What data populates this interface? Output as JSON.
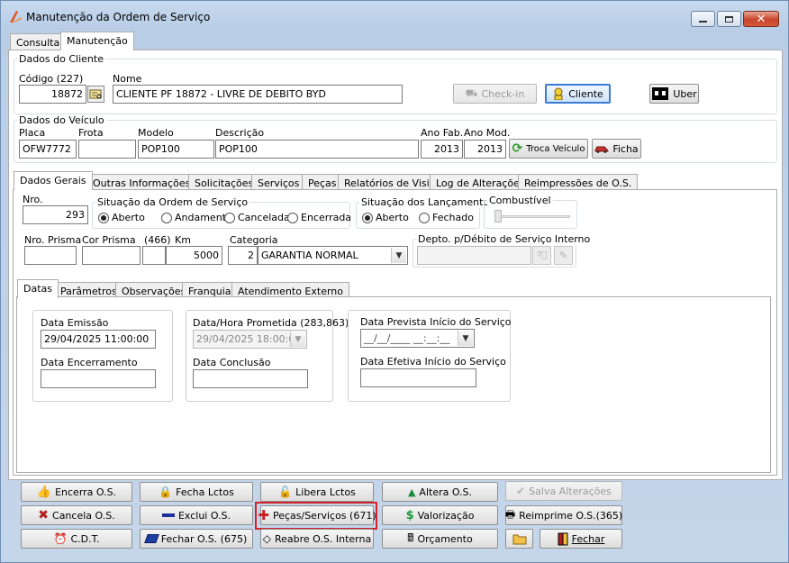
{
  "window": {
    "title": "Manutenção da Ordem de Serviço"
  },
  "top_tabs": [
    "Consulta",
    "Manutenção"
  ],
  "cliente": {
    "group": "Dados do Cliente",
    "codigo_label": "Código (227)",
    "codigo": "18872",
    "nome_label": "Nome",
    "nome": "CLIENTE PF 18872 - LIVRE DE DEBITO BYD",
    "checkin": "Check-in",
    "cliente_btn": "Cliente",
    "uber_btn": "Uber"
  },
  "veiculo": {
    "group": "Dados do Veículo",
    "placa_label": "Placa",
    "placa": "OFW7772",
    "frota_label": "Frota",
    "frota": "",
    "modelo_label": "Modelo",
    "modelo": "POP100",
    "descricao_label": "Descrição",
    "descricao": "POP100",
    "anofab_label": "Ano Fab.",
    "anofab": "2013",
    "anomod_label": "Ano Mod.",
    "anomod": "2013",
    "troca_btn": "Troca Veículo",
    "ficha_btn": "Ficha"
  },
  "main_tabs": [
    "Dados Gerais",
    "Outras Informações",
    "Solicitações",
    "Serviços",
    "Peças",
    "Relatórios de Visita",
    "Log de Alterações",
    "Reimpressões de O.S."
  ],
  "gerais": {
    "nro_label": "Nro.",
    "nro": "293",
    "situacao_group": "Situação da Ordem de Serviço",
    "situacao_options": [
      "Aberto",
      "Andamento",
      "Cancelada",
      "Encerrada"
    ],
    "situacao_selected": "Aberto",
    "lanc_group": "Situação dos Lançamentos",
    "lanc_options": [
      "Aberto",
      "Fechado"
    ],
    "lanc_selected": "Aberto",
    "combustivel_group": "Combustível",
    "nro_prisma_label": "Nro. Prisma",
    "nro_prisma": "",
    "cor_prisma_label": "Cor Prisma",
    "cor_prisma": "",
    "km_code_label": "(466)",
    "km_label": "Km",
    "km": "5000",
    "categoria_label": "Categoria",
    "categoria_code": "2",
    "categoria": "GARANTIA NORMAL",
    "depto_group": "Depto. p/Débito de Serviço Interno"
  },
  "sub_tabs": [
    "Datas",
    "Parâmetros",
    "Observações",
    "Franquia",
    "Atendimento Externo"
  ],
  "datas": {
    "emissao_label": "Data Emissão",
    "emissao": "29/04/2025 11:00:00",
    "encerramento_label": "Data Encerramento",
    "encerramento": "",
    "prometida_label": "Data/Hora Prometida (283,863)",
    "prometida": "29/04/2025 18:00:00",
    "conclusao_label": "Data Conclusão",
    "conclusao": "",
    "prev_inicio_label": "Data Prevista Início do Serviço",
    "prev_inicio": "__/__/____ __:__:__",
    "efet_inicio_label": "Data Efetiva Início do Serviço",
    "efet_inicio": ""
  },
  "actions": {
    "encerra": "Encerra O.S.",
    "fecha_lctos": "Fecha Lctos",
    "libera_lctos": "Libera Lctos",
    "altera": "Altera O.S.",
    "salva": "Salva Alterações",
    "cancela": "Cancela O.S.",
    "exclui": "Exclui O.S.",
    "pecas_servicos": "Peças/Serviços (671)",
    "valorizacao": "Valorização",
    "reimprime": "Reimprime O.S.(365)",
    "cdt": "C.D.T.",
    "fechar_os": "Fechar O.S. (675)",
    "reabre": "Reabre O.S. Interna",
    "orcamento": "Orçamento",
    "fechar": "Fechar"
  },
  "colors": {
    "highlight": "#d2232a",
    "accent": "#3a7bd5"
  }
}
